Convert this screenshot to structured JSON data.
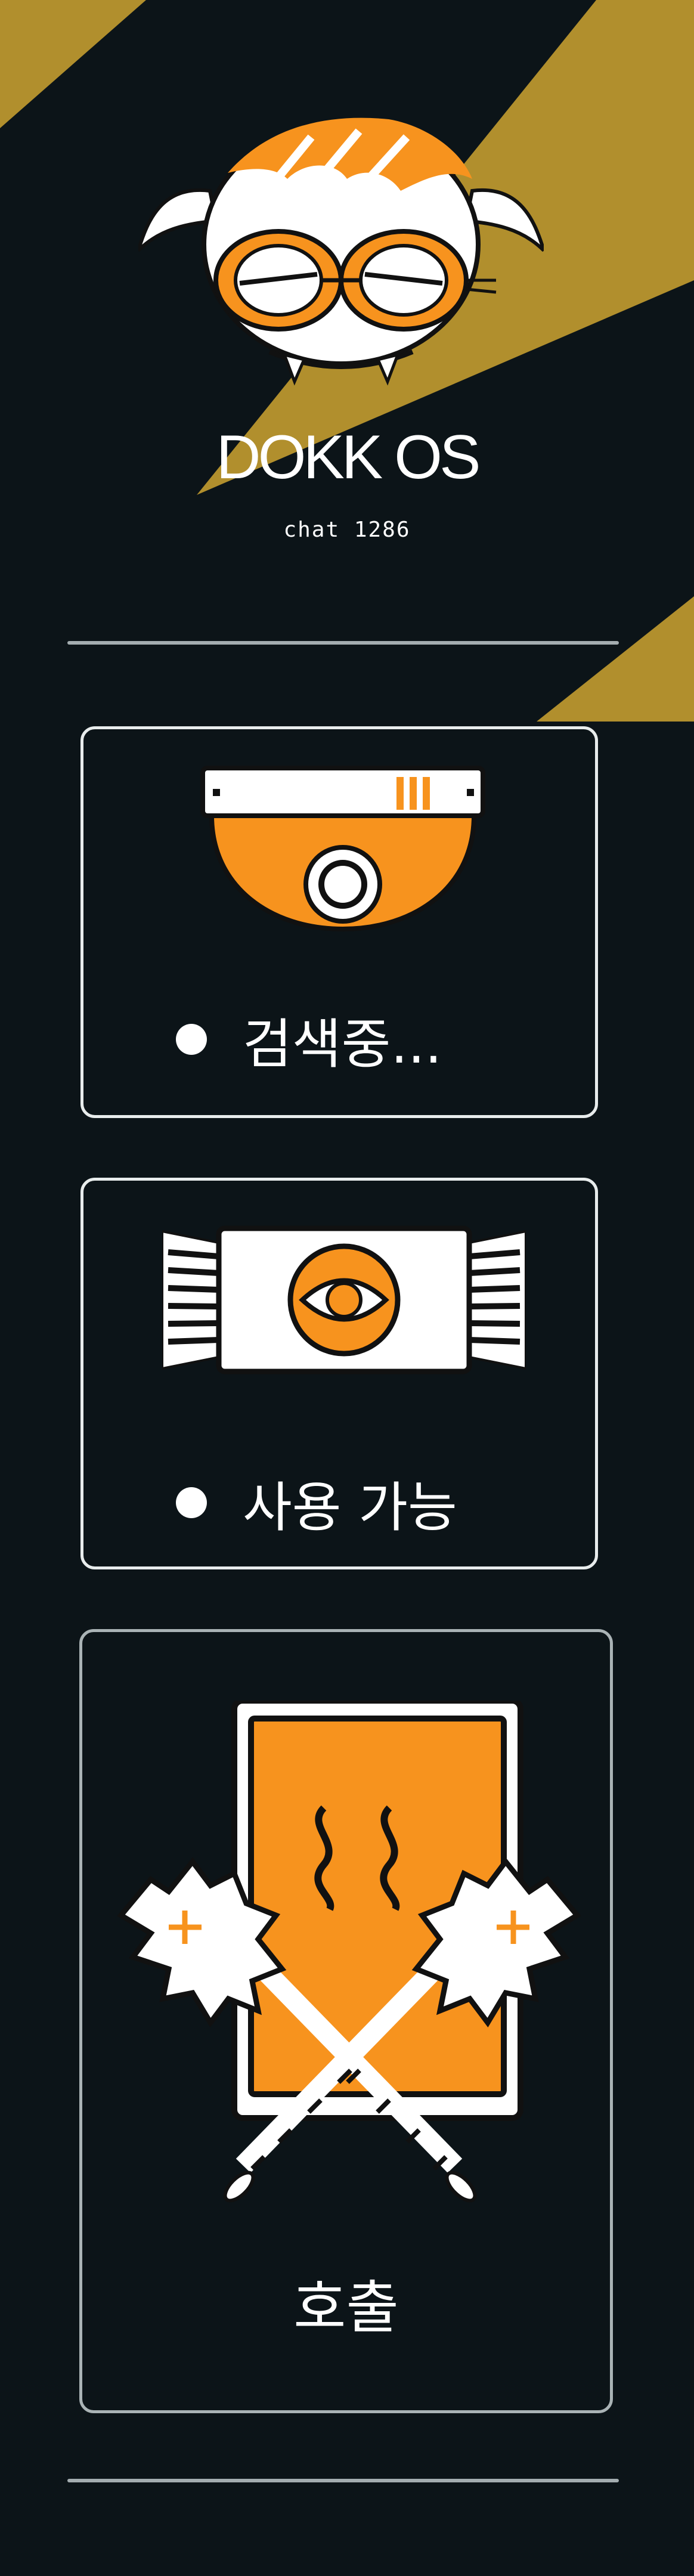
{
  "header": {
    "title": "DOKK OS",
    "subtitle": "chat 1286"
  },
  "gadgets": [
    {
      "icon": "camera-dome-icon",
      "status": "검색중..."
    },
    {
      "icon": "eye-device-icon",
      "status": "사용 가능"
    }
  ],
  "action": {
    "icon": "phone-maces-icon",
    "label": "호출"
  },
  "colors": {
    "background": "#0c1418",
    "accent": "#f7931e",
    "gold": "#b18f2d",
    "border": "#e8ecec"
  }
}
